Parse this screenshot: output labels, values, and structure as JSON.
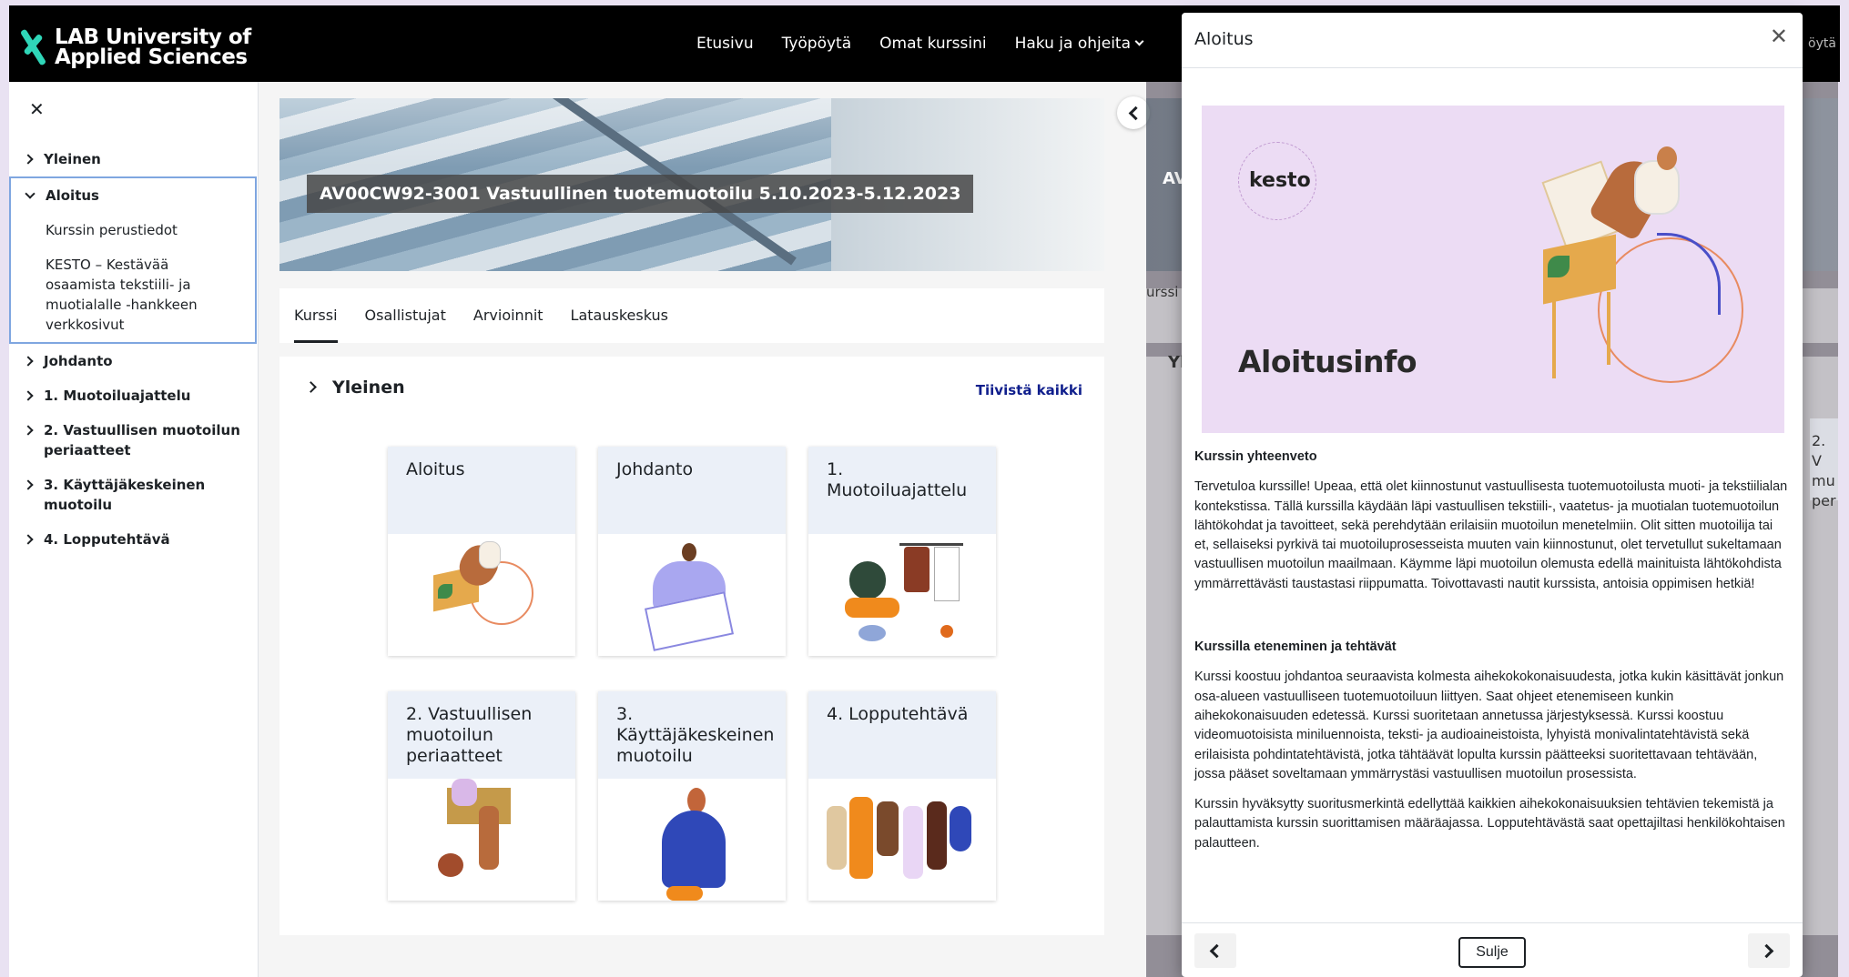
{
  "brand": {
    "line1": "LAB University of",
    "line2": "Applied Sciences",
    "accent": "#2fd6b8"
  },
  "nav": {
    "items": [
      "Etusivu",
      "Työpöytä",
      "Omat kurssini",
      "Haku ja ohjeita"
    ]
  },
  "drawer": {
    "sections": [
      {
        "label": "Yleinen",
        "open": false,
        "subs": []
      },
      {
        "label": "Aloitus",
        "open": true,
        "subs": [
          "Kurssin perustiedot",
          "KESTO – Kestävää osaamista tekstiili- ja muotialalle -hankkeen verkkosivut"
        ]
      },
      {
        "label": "Johdanto",
        "open": false,
        "subs": []
      },
      {
        "label": "1. Muotoiluajattelu",
        "open": false,
        "subs": []
      },
      {
        "label": "2. Vastuullisen muotoilun periaatteet",
        "open": false,
        "subs": []
      },
      {
        "label": "3. Käyttäjäkeskeinen muotoilu",
        "open": false,
        "subs": []
      },
      {
        "label": "4. Lopputehtävä",
        "open": false,
        "subs": []
      }
    ]
  },
  "course": {
    "title": "AV00CW92-3001 Vastuullinen tuotemuotoilu 5.10.2023-5.12.2023",
    "tabs": [
      "Kurssi",
      "Osallistujat",
      "Arvioinnit",
      "Latauskeskus"
    ],
    "section_heading": "Yleinen",
    "collapse_all": "Tiivistä kaikki",
    "tiles": [
      "Aloitus",
      "Johdanto",
      "1. Muotoiluajattelu",
      "2. Vastuullisen muotoilun periaatteet",
      "3. Käyttäjäkeskeinen muotoilu",
      "4. Lopputehtävä"
    ]
  },
  "modal": {
    "title": "Aloitus",
    "hero": {
      "badge": "kesto",
      "title": "Aloitusinfo"
    },
    "h1": "Kurssin yhteenveto",
    "p1": "Tervetuloa kurssille! Upeaa, että olet kiinnostunut vastuullisesta tuotemuotoilusta muoti- ja tekstiilialan kontekstissa. Tällä kurssilla käydään läpi vastuullisen tekstiili-, vaatetus- ja muotialan tuotemuotoilun lähtökohdat ja tavoitteet, sekä perehdytään erilaisiin muotoilun menetelmiin. Olit sitten muotoilija tai et, sellaiseksi pyrkivä tai muotoiluprosesseista muuten vain kiinnostunut, olet tervetullut sukeltamaan vastuullisen muotoilun maailmaan. Käymme läpi muotoilun olemusta edellä mainituista lähtökohdista ymmärrettävästi taustastasi riippumatta. Toivottavasti nautit kurssista, antoisia oppimisen hetkiä!",
    "h2": "Kurssilla eteneminen ja tehtävät",
    "p2": "Kurssi koostuu johdantoa seuraavista kolmesta aihekokokonaisuudesta, jotka kukin käsittävät jonkun osa-alueen vastuulliseen tuotemuotoiluun liittyen. Saat ohjeet etenemiseen kunkin aihekokonaisuuden edetessä. Kurssi suoritetaan annetussa järjestyksessä. Kurssi koostuu videomuotoisista miniluennoista, teksti- ja audioaineistoista, lyhyistä monivalintatehtävistä sekä erilaisista pohdintatehtävistä, jotka tähtäävät lopulta kurssin päätteeksi suoritettavaan tehtävään, jossa pääset soveltamaan ymmärrystäsi vastuullisen muotoilun prosessista.",
    "p3": "Kurssin hyväksytty suoritusmerkintä edellyttää kaikkien aihekokonaisuuksien tehtävien tekemistä ja palauttamista kurssin suorittamisen määräajassa. Lopputehtävästä saat opettajiltasi henkilökohtaisen palautteen.",
    "close_label": "Sulje"
  },
  "peek": {
    "banner": "AV",
    "tab": "urssi",
    "section": "Yl",
    "tile": "2. V\nmu\nper",
    "nav": "öytä"
  }
}
